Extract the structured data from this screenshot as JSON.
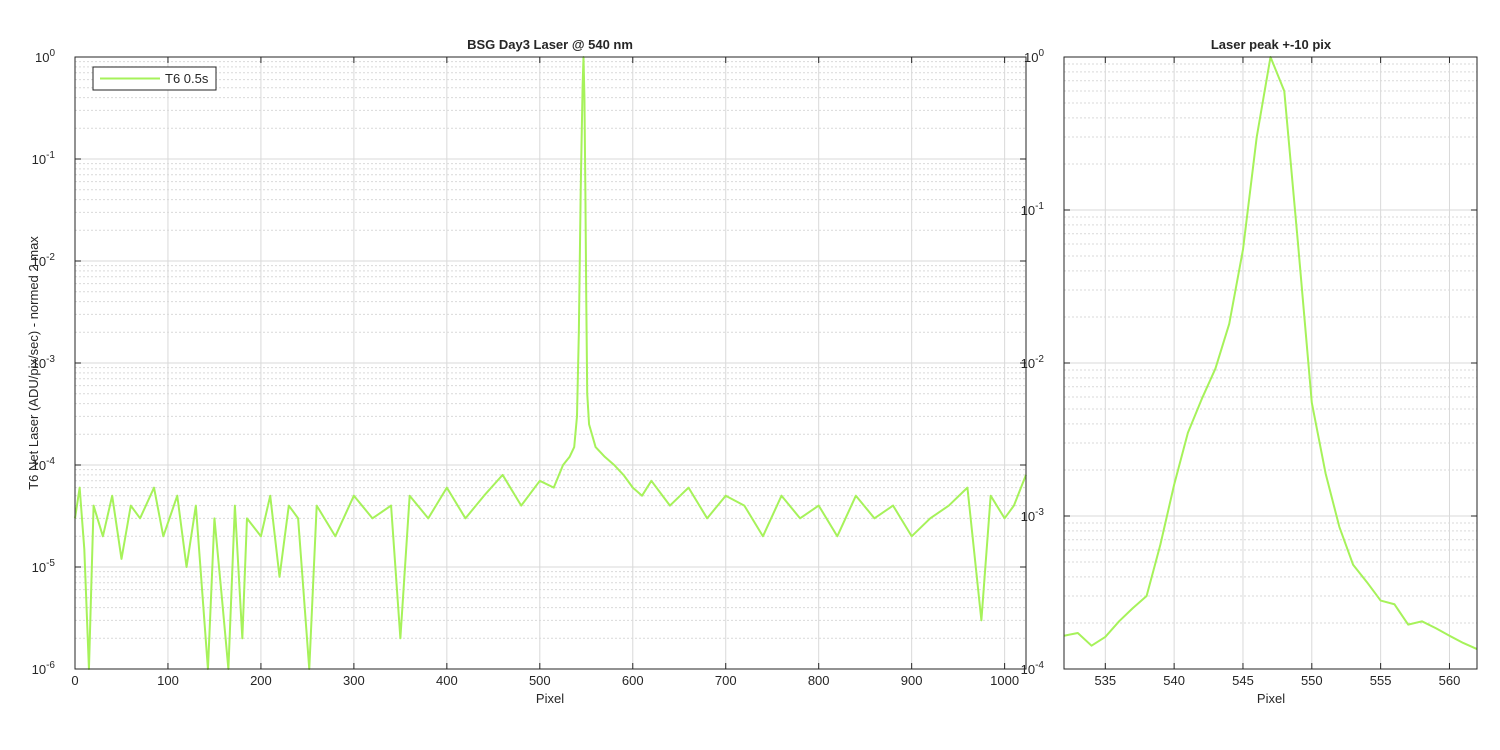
{
  "colors": {
    "series": "#a6f25a",
    "grid_major": "#d9d9d9",
    "grid_minor": "#d9d9d9",
    "axis": "#262626"
  },
  "chart_data": [
    {
      "type": "line",
      "title": "BSG  Day3 Laser @ 540 nm",
      "xlabel": "Pixel",
      "ylabel": "T6 Net Laser (ADU/pix/sec) - normed 2 max",
      "yscale": "log",
      "xlim": [
        0,
        1023
      ],
      "ylim": [
        1e-06,
        1
      ],
      "grid": "on",
      "legend_position": "top-left",
      "xticks": [
        "0",
        "100",
        "200",
        "300",
        "400",
        "500",
        "600",
        "700",
        "800",
        "900",
        "1000"
      ],
      "yticks": [
        {
          "base": "10",
          "exp": "-6"
        },
        {
          "base": "10",
          "exp": "-5"
        },
        {
          "base": "10",
          "exp": "-4"
        },
        {
          "base": "10",
          "exp": "-3"
        },
        {
          "base": "10",
          "exp": "-2"
        },
        {
          "base": "10",
          "exp": "-1"
        },
        {
          "base": "10",
          "exp": "0"
        }
      ],
      "series": [
        {
          "name": "T6 0.5s",
          "points": [
            [
              0,
              3e-05
            ],
            [
              5,
              6e-05
            ],
            [
              10,
              1.5e-05
            ],
            [
              15,
              1e-06
            ],
            [
              20,
              4e-05
            ],
            [
              30,
              2e-05
            ],
            [
              40,
              5e-05
            ],
            [
              50,
              1.2e-05
            ],
            [
              60,
              4e-05
            ],
            [
              70,
              3e-05
            ],
            [
              85,
              6e-05
            ],
            [
              95,
              2e-05
            ],
            [
              110,
              5e-05
            ],
            [
              120,
              1e-05
            ],
            [
              130,
              4e-05
            ],
            [
              143,
              1e-06
            ],
            [
              150,
              3e-05
            ],
            [
              158,
              5e-06
            ],
            [
              165,
              1e-06
            ],
            [
              172,
              4e-05
            ],
            [
              180,
              2e-06
            ],
            [
              185,
              3e-05
            ],
            [
              200,
              2e-05
            ],
            [
              210,
              5e-05
            ],
            [
              220,
              8e-06
            ],
            [
              230,
              4e-05
            ],
            [
              240,
              3e-05
            ],
            [
              252,
              1e-06
            ],
            [
              260,
              4e-05
            ],
            [
              280,
              2e-05
            ],
            [
              300,
              5e-05
            ],
            [
              320,
              3e-05
            ],
            [
              340,
              4e-05
            ],
            [
              350,
              2e-06
            ],
            [
              360,
              5e-05
            ],
            [
              380,
              3e-05
            ],
            [
              400,
              6e-05
            ],
            [
              420,
              3e-05
            ],
            [
              440,
              5e-05
            ],
            [
              460,
              8e-05
            ],
            [
              480,
              4e-05
            ],
            [
              500,
              7e-05
            ],
            [
              515,
              6e-05
            ],
            [
              525,
              0.0001
            ],
            [
              532,
              0.00012
            ],
            [
              537,
              0.00015
            ],
            [
              540,
              0.0003
            ],
            [
              542,
              0.002
            ],
            [
              544,
              0.05
            ],
            [
              546,
              0.5
            ],
            [
              547,
              1
            ],
            [
              548,
              0.4
            ],
            [
              549,
              0.05
            ],
            [
              550,
              0.004
            ],
            [
              551,
              0.0005
            ],
            [
              553,
              0.00025
            ],
            [
              560,
              0.00015
            ],
            [
              570,
              0.00012
            ],
            [
              580,
              0.0001
            ],
            [
              590,
              8e-05
            ],
            [
              600,
              6e-05
            ],
            [
              610,
              5e-05
            ],
            [
              620,
              7e-05
            ],
            [
              640,
              4e-05
            ],
            [
              660,
              6e-05
            ],
            [
              680,
              3e-05
            ],
            [
              700,
              5e-05
            ],
            [
              720,
              4e-05
            ],
            [
              740,
              2e-05
            ],
            [
              760,
              5e-05
            ],
            [
              780,
              3e-05
            ],
            [
              800,
              4e-05
            ],
            [
              820,
              2e-05
            ],
            [
              840,
              5e-05
            ],
            [
              860,
              3e-05
            ],
            [
              880,
              4e-05
            ],
            [
              900,
              2e-05
            ],
            [
              920,
              3e-05
            ],
            [
              940,
              4e-05
            ],
            [
              960,
              6e-05
            ],
            [
              975,
              3e-06
            ],
            [
              985,
              5e-05
            ],
            [
              1000,
              3e-05
            ],
            [
              1010,
              4e-05
            ],
            [
              1023,
              8e-05
            ]
          ]
        }
      ]
    },
    {
      "type": "line",
      "title": "Laser peak +-10 pix",
      "xlabel": "Pixel",
      "ylabel": "",
      "yscale": "log",
      "xlim": [
        532,
        562
      ],
      "ylim": [
        0.0001,
        1
      ],
      "grid": "on",
      "xticks": [
        "535",
        "540",
        "545",
        "550",
        "555",
        "560"
      ],
      "yticks": [
        {
          "base": "10",
          "exp": "-4"
        },
        {
          "base": "10",
          "exp": "-3"
        },
        {
          "base": "10",
          "exp": "-2"
        },
        {
          "base": "10",
          "exp": "-1"
        },
        {
          "base": "10",
          "exp": "0"
        }
      ],
      "series": [
        {
          "name": "T6 0.5s",
          "points": [
            [
              532,
              0.000165
            ],
            [
              533,
              0.000172
            ],
            [
              534,
              0.000142
            ],
            [
              535,
              0.000162
            ],
            [
              536,
              0.000205
            ],
            [
              537,
              0.00025
            ],
            [
              538,
              0.0003
            ],
            [
              539,
              0.00065
            ],
            [
              540,
              0.0016
            ],
            [
              541,
              0.0035
            ],
            [
              542,
              0.0058
            ],
            [
              543,
              0.0092
            ],
            [
              544,
              0.018
            ],
            [
              545,
              0.055
            ],
            [
              546,
              0.3
            ],
            [
              547,
              1.0
            ],
            [
              548,
              0.6
            ],
            [
              549,
              0.06
            ],
            [
              550,
              0.0055
            ],
            [
              551,
              0.0019
            ],
            [
              552,
              0.00085
            ],
            [
              553,
              0.00048
            ],
            [
              554,
              0.00037
            ],
            [
              555,
              0.00028
            ],
            [
              556,
              0.000265
            ],
            [
              557,
              0.000195
            ],
            [
              558,
              0.000205
            ],
            [
              559,
              0.000185
            ],
            [
              560,
              0.000165
            ],
            [
              561,
              0.000148
            ],
            [
              562,
              0.000135
            ]
          ]
        }
      ]
    }
  ]
}
